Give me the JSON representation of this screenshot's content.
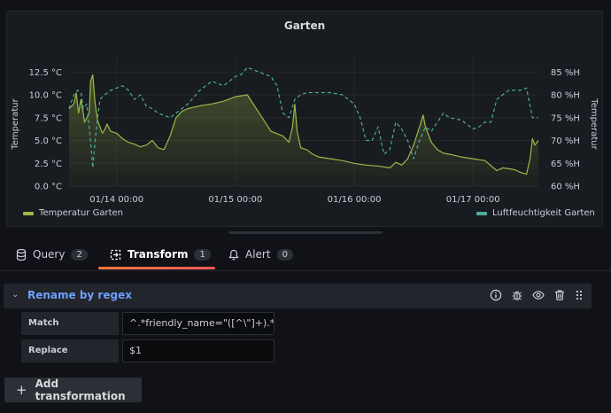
{
  "panel": {
    "title": "Garten",
    "left_axis_label": "Temperatur",
    "right_axis_label": "Temperatur",
    "legend": [
      {
        "name": "Temperatur Garten",
        "color": "#9ab847"
      },
      {
        "name": "Luftfeuchtigkeit Garten",
        "color": "#4dac9c"
      }
    ]
  },
  "chart_data": {
    "type": "line",
    "title": "Garten",
    "ylabel": "Temperatur",
    "y2label": "Temperatur",
    "x_ticks": [
      "01/14 00:00",
      "01/15 00:00",
      "01/16 00:00",
      "01/17 00:00"
    ],
    "y_ticks": [
      "0.0 °C",
      "2.5 °C",
      "5.0 °C",
      "7.5 °C",
      "10.0 °C",
      "12.5 °C"
    ],
    "y2_ticks": [
      "60 %H",
      "65 %H",
      "70 %H",
      "75 %H",
      "80 %H",
      "85 %H"
    ],
    "ylim": [
      0,
      13.5
    ],
    "y2lim": [
      60,
      87
    ],
    "xlim": [
      -0.4,
      3.55
    ],
    "grid": true,
    "legend_position": "bottom",
    "series": [
      {
        "name": "Temperatur Garten",
        "axis": "left",
        "color": "#9ab847",
        "style": "solid",
        "fill": true,
        "x": [
          -0.4,
          -0.36,
          -0.34,
          -0.32,
          -0.3,
          -0.28,
          -0.27,
          -0.25,
          -0.23,
          -0.22,
          -0.2,
          -0.18,
          -0.16,
          -0.14,
          -0.12,
          -0.1,
          -0.08,
          -0.05,
          0.0,
          0.05,
          0.1,
          0.15,
          0.2,
          0.25,
          0.3,
          0.35,
          0.4,
          0.45,
          0.5,
          0.55,
          0.6,
          0.7,
          0.8,
          0.9,
          1.0,
          1.1,
          1.2,
          1.3,
          1.4,
          1.45,
          1.48,
          1.5,
          1.52,
          1.55,
          1.6,
          1.65,
          1.7,
          1.8,
          1.9,
          2.0,
          2.1,
          2.2,
          2.3,
          2.35,
          2.4,
          2.45,
          2.5,
          2.55,
          2.58,
          2.6,
          2.65,
          2.7,
          2.75,
          2.8,
          2.9,
          3.0,
          3.1,
          3.2,
          3.25,
          3.3,
          3.35,
          3.4,
          3.45,
          3.48,
          3.5,
          3.52,
          3.55
        ],
        "values": [
          8.5,
          9.0,
          10.2,
          8.0,
          9.5,
          8.0,
          7.0,
          7.5,
          8.0,
          11.5,
          12.2,
          9.0,
          7.2,
          6.5,
          5.8,
          6.2,
          6.8,
          6.0,
          5.8,
          5.2,
          4.8,
          4.6,
          4.3,
          4.5,
          5.0,
          4.2,
          4.0,
          5.5,
          7.5,
          8.2,
          8.5,
          8.8,
          9.0,
          9.3,
          9.8,
          10.0,
          8.0,
          6.0,
          5.5,
          4.8,
          6.5,
          9.0,
          6.0,
          4.2,
          4.0,
          3.5,
          3.2,
          3.0,
          2.8,
          2.5,
          2.3,
          2.2,
          2.0,
          2.6,
          2.3,
          3.0,
          4.5,
          6.5,
          7.8,
          6.5,
          4.8,
          4.0,
          3.6,
          3.5,
          3.2,
          3.0,
          2.8,
          1.7,
          2.0,
          1.9,
          1.8,
          1.5,
          1.3,
          3.0,
          5.2,
          4.5,
          5.0
        ]
      },
      {
        "name": "Luftfeuchtigkeit Garten",
        "axis": "right",
        "color": "#4dac9c",
        "style": "dashed",
        "fill": false,
        "x": [
          -0.4,
          -0.36,
          -0.33,
          -0.3,
          -0.28,
          -0.25,
          -0.22,
          -0.2,
          -0.18,
          -0.16,
          -0.14,
          -0.1,
          -0.05,
          0.0,
          0.05,
          0.1,
          0.15,
          0.2,
          0.25,
          0.3,
          0.35,
          0.4,
          0.45,
          0.5,
          0.6,
          0.7,
          0.8,
          0.9,
          1.0,
          1.05,
          1.1,
          1.15,
          1.2,
          1.3,
          1.35,
          1.4,
          1.45,
          1.5,
          1.55,
          1.6,
          1.7,
          1.8,
          1.9,
          2.0,
          2.05,
          2.1,
          2.15,
          2.2,
          2.25,
          2.3,
          2.35,
          2.4,
          2.45,
          2.5,
          2.55,
          2.6,
          2.65,
          2.7,
          2.75,
          2.8,
          2.9,
          3.0,
          3.05,
          3.1,
          3.15,
          3.2,
          3.25,
          3.3,
          3.35,
          3.4,
          3.45,
          3.5,
          3.55
        ],
        "values": [
          77,
          80,
          81,
          80.5,
          77,
          78,
          70,
          64,
          70,
          75,
          79,
          80,
          81,
          81.5,
          82,
          81,
          79,
          80,
          77.5,
          77,
          76,
          75.5,
          75,
          76,
          78,
          81,
          83,
          82,
          84,
          84.5,
          86,
          85.5,
          85,
          84,
          82,
          76,
          75,
          79,
          80,
          80.5,
          80.5,
          80.5,
          80,
          78,
          75,
          70,
          70,
          73,
          67,
          68,
          74,
          72.5,
          70,
          66,
          70,
          73,
          72,
          74,
          76,
          75,
          74.5,
          72.5,
          73,
          74,
          74,
          79,
          80,
          81,
          81,
          81,
          81.5,
          75,
          75
        ]
      }
    ]
  },
  "tabs": [
    {
      "label": "Query",
      "count": "2",
      "icon": "database-icon",
      "active": false
    },
    {
      "label": "Transform",
      "count": "1",
      "icon": "transform-icon",
      "active": true
    },
    {
      "label": "Alert",
      "count": "0",
      "icon": "bell-icon",
      "active": false
    }
  ],
  "transformation": {
    "title": "Rename by regex",
    "header_icons": [
      "info-icon",
      "debug-icon",
      "eye-icon",
      "trash-icon",
      "drag-handle-icon"
    ],
    "match_label": "Match",
    "match_value": "^.*friendly_name=\"([^\\\"]+).*",
    "replace_label": "Replace",
    "replace_value": "$1"
  },
  "add_button_label": "Add transformation"
}
